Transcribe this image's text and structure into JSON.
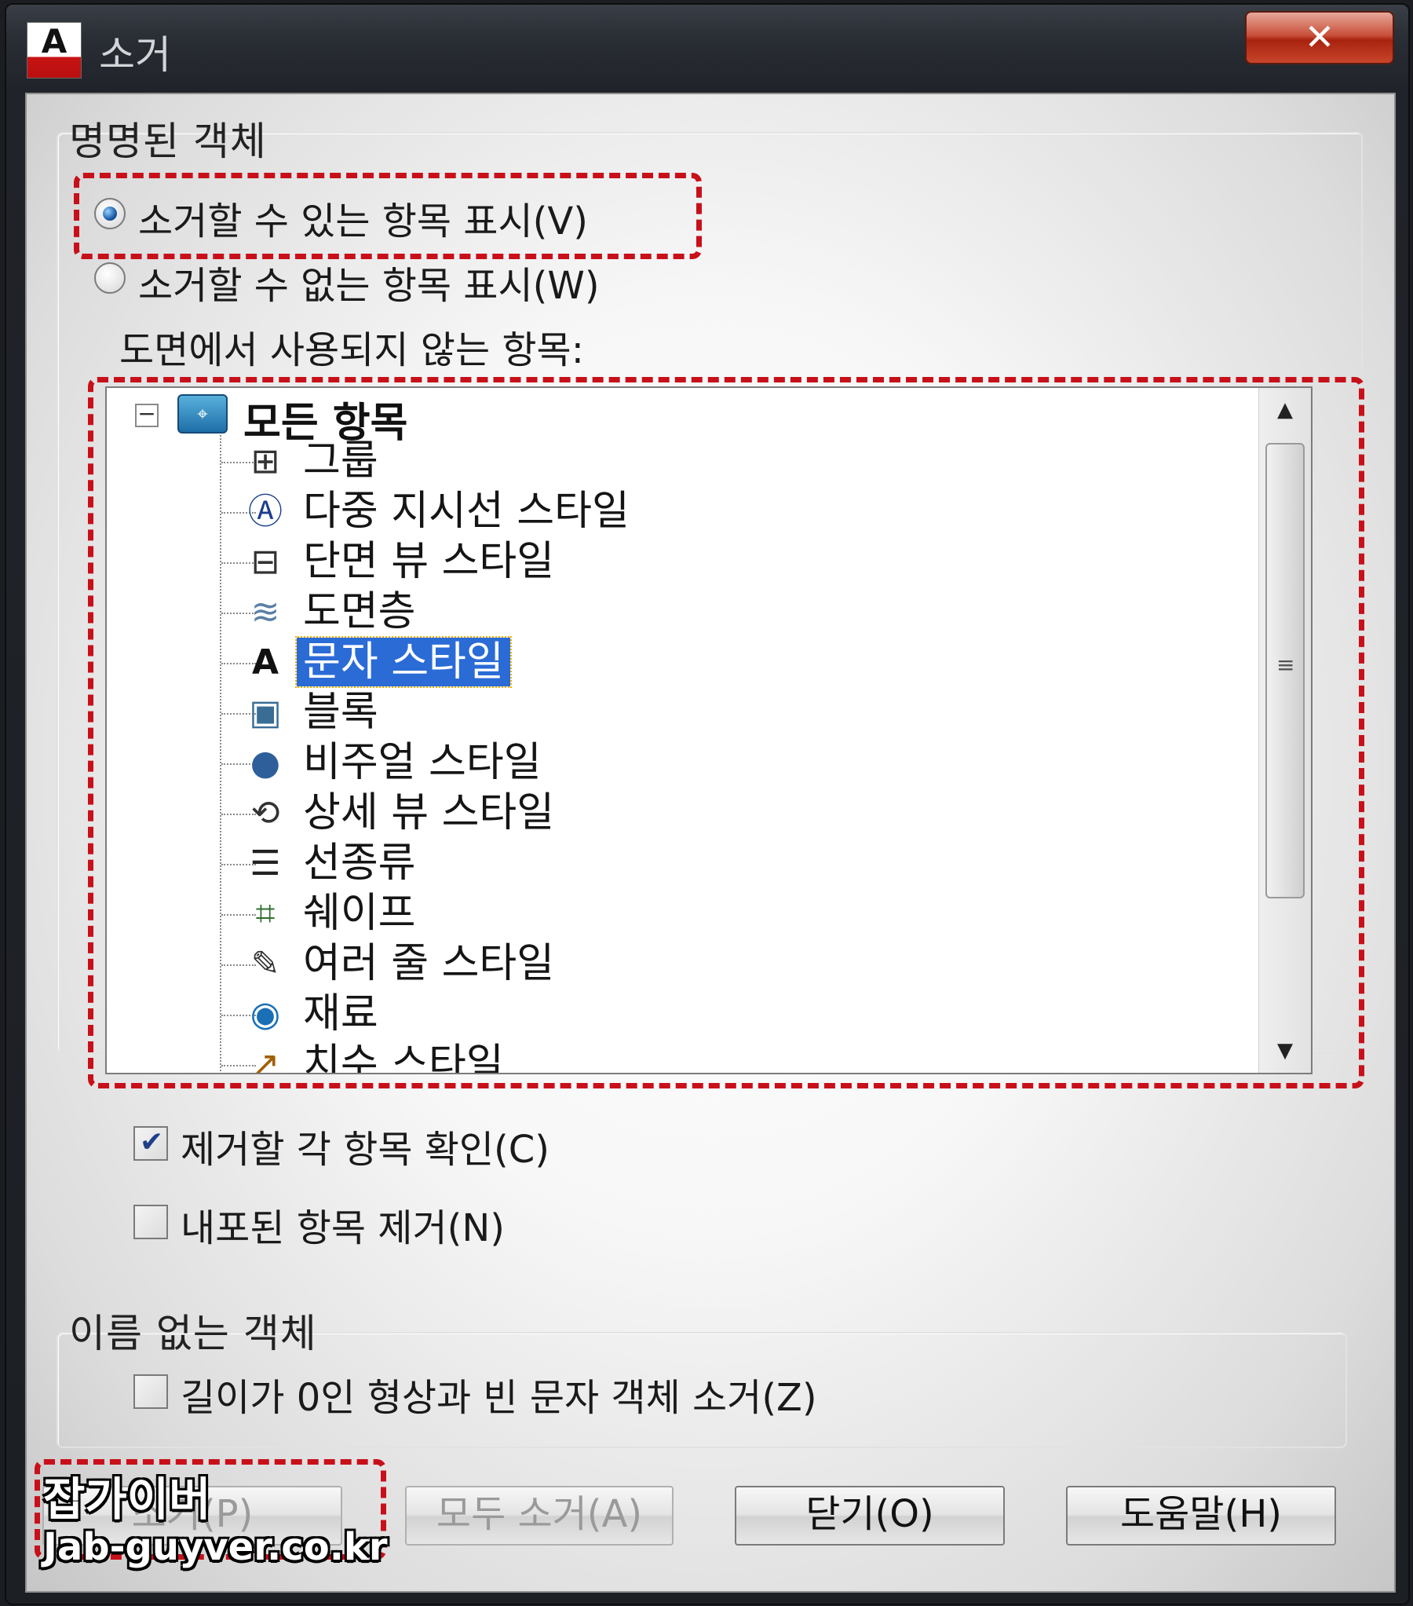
{
  "window": {
    "title": "소거",
    "close_label": "✕"
  },
  "named_objects": {
    "group_label": "명명된 객체",
    "radio_purgeable": "소거할 수 있는 항목 표시(V)",
    "radio_non_purgeable": "소거할 수 없는 항목 표시(W)",
    "list_label": "도면에서 사용되지 않는 항목:",
    "tree": {
      "root": "모든 항목",
      "items": [
        {
          "label": "그룹",
          "icon": "group-icon",
          "glyph": "⊞"
        },
        {
          "label": "다중 지시선 스타일",
          "icon": "multileader-style-icon",
          "glyph": "Ⓐ"
        },
        {
          "label": "단면 뷰 스타일",
          "icon": "section-view-style-icon",
          "glyph": "⊟"
        },
        {
          "label": "도면층",
          "icon": "layer-icon",
          "glyph": "≋"
        },
        {
          "label": "문자 스타일",
          "icon": "text-style-icon",
          "glyph": "A",
          "selected": true
        },
        {
          "label": "블록",
          "icon": "block-icon",
          "glyph": "▣"
        },
        {
          "label": "비주얼 스타일",
          "icon": "visual-style-icon",
          "glyph": "●"
        },
        {
          "label": "상세 뷰 스타일",
          "icon": "detail-view-style-icon",
          "glyph": "⟲"
        },
        {
          "label": "선종류",
          "icon": "linetype-icon",
          "glyph": "☰"
        },
        {
          "label": "쉐이프",
          "icon": "shape-icon",
          "glyph": "⌗"
        },
        {
          "label": "여러 줄 스타일",
          "icon": "multiline-style-icon",
          "glyph": "✎"
        },
        {
          "label": "재료",
          "icon": "material-icon",
          "glyph": "◉"
        },
        {
          "label": "치수 스타일",
          "icon": "dimension-style-icon",
          "glyph": "↗"
        }
      ]
    },
    "check_confirm": "제거할 각 항목 확인(C)",
    "check_nested": "내포된 항목 제거(N)"
  },
  "unnamed_objects": {
    "group_label": "이름 없는 객체",
    "check_zero_length": "길이가 0인 형상과 빈 문자 객체 소거(Z)"
  },
  "buttons": {
    "purge": "소거(P)",
    "purge_all": "모두 소거(A)",
    "close": "닫기(O)",
    "help": "도움말(H)"
  },
  "watermark": {
    "name": "잡가이버",
    "url": "Jab-guyver.co.kr"
  },
  "colors": {
    "highlight": "#c8101a",
    "selection": "#2a6bd6"
  }
}
